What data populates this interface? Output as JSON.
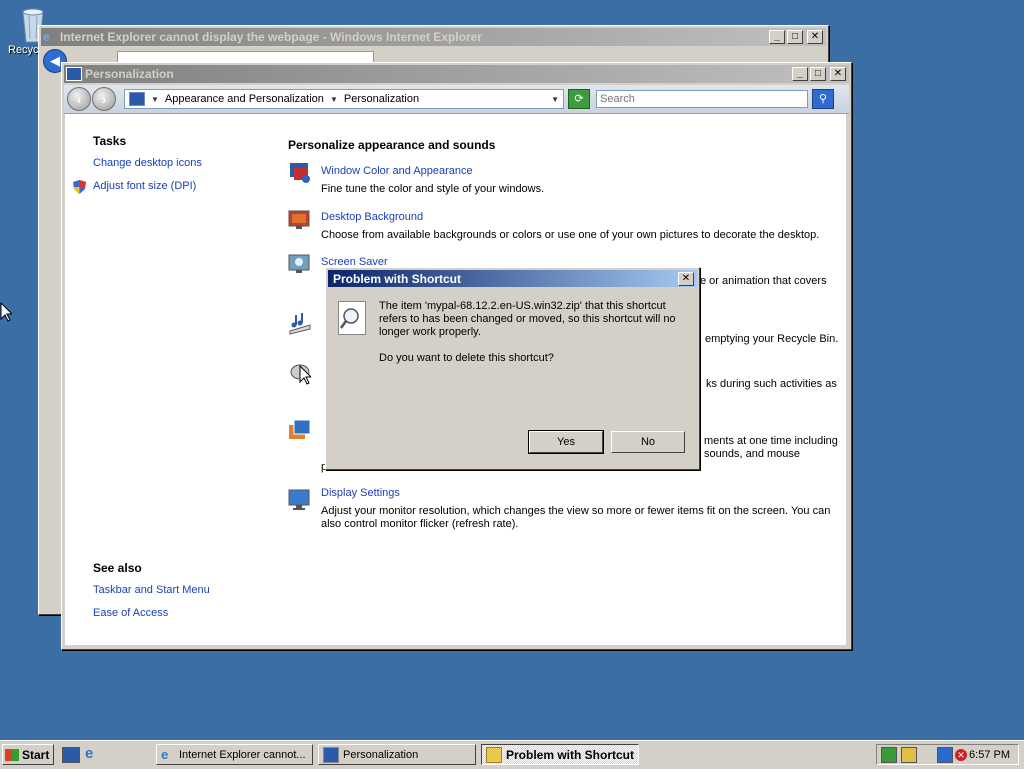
{
  "desktop": {
    "recycle_label": "Recycle Bin"
  },
  "ie_window": {
    "title": "Internet Explorer cannot display the webpage - Windows Internet Explorer"
  },
  "personalization_window": {
    "title": "Personalization",
    "breadcrumb": [
      "Appearance and Personalization",
      "Personalization"
    ],
    "search_placeholder": "Search",
    "tasks": {
      "heading": "Tasks",
      "links": [
        "Change desktop icons",
        "Adjust font size (DPI)"
      ]
    },
    "see_also": {
      "heading": "See also",
      "links": [
        "Taskbar and Start Menu",
        "Ease of Access"
      ]
    },
    "main_heading": "Personalize appearance and sounds",
    "items": [
      {
        "title": "Window Color and Appearance",
        "desc": "Fine tune the color and style of your windows."
      },
      {
        "title": "Desktop Background",
        "desc": "Choose from available backgrounds or colors or use one of your own pictures to decorate the desktop."
      },
      {
        "title": "Screen Saver",
        "desc_fragment": "e or animation that covers"
      },
      {
        "desc_fragment": "emptying your Recycle Bin."
      },
      {
        "desc_fragment": "ks during such activities as"
      },
      {
        "desc_fragment_1": "ments at one time including",
        "desc_fragment_2": "sounds, and mouse",
        "desc_fragment_3": "pointers."
      },
      {
        "title": "Display Settings",
        "desc": "Adjust your monitor resolution, which changes the view so more or fewer items fit on the screen. You can also control monitor flicker (refresh rate)."
      }
    ]
  },
  "dialog": {
    "title": "Problem with Shortcut",
    "message": "The item 'mypal-68.12.2.en-US.win32.zip' that this shortcut refers to has been changed or moved, so this shortcut will no longer work properly.",
    "question": "Do you want to delete this shortcut?",
    "yes_label": "Yes",
    "no_label": "No"
  },
  "taskbar": {
    "start_label": "Start",
    "tasks": [
      "Internet Explorer cannot...",
      "Personalization",
      "Problem with Shortcut"
    ],
    "clock": "6:57 PM"
  },
  "colors": {
    "desktop": "#3a6ea5",
    "titlebar_active": "#0a246a",
    "link": "#1a3fb8"
  }
}
